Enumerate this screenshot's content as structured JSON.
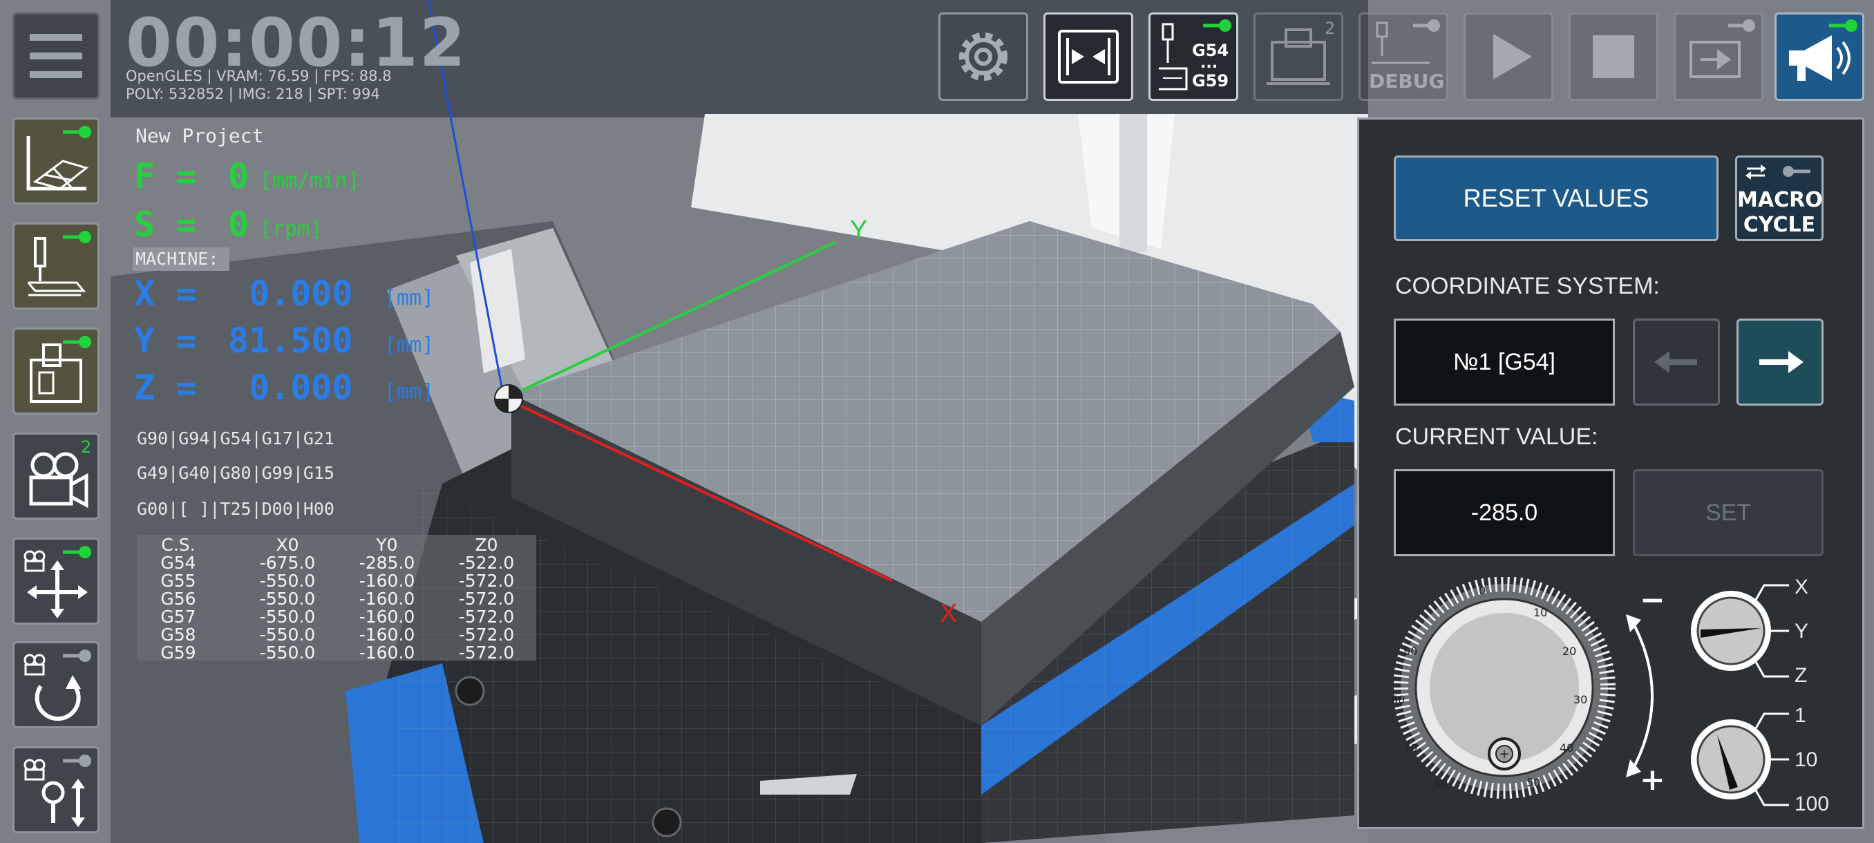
{
  "timer": "00:00:12",
  "stats_line1": "OpenGLES | VRAM: 76.59 | FPS: 88.8",
  "stats_line2": "POLY: 532852 | IMG: 218 | SPT: 994",
  "project_name": "New Project",
  "feed": {
    "label": "F =",
    "value": "0",
    "unit": "[mm/min]"
  },
  "speed": {
    "label": "S =",
    "value": "0",
    "unit": "[rpm]"
  },
  "machine_label": "MACHINE:",
  "axes": [
    {
      "label": "X =",
      "value": "0.000",
      "unit": "[mm]"
    },
    {
      "label": "Y =",
      "value": "81.500",
      "unit": "[mm]"
    },
    {
      "label": "Z =",
      "value": "0.000",
      "unit": "[mm]"
    }
  ],
  "gcode_lines": [
    "G90|G94|G54|G17|G21",
    "G49|G40|G80|G99|G15",
    "G00|[ ]|T25|D00|H00"
  ],
  "cs_table": {
    "headers": [
      "C.S.",
      "X0",
      "Y0",
      "Z0"
    ],
    "rows": [
      [
        "G54",
        "-675.0",
        "-285.0",
        "-522.0"
      ],
      [
        "G55",
        "-550.0",
        "-160.0",
        "-572.0"
      ],
      [
        "G56",
        "-550.0",
        "-160.0",
        "-572.0"
      ],
      [
        "G57",
        "-550.0",
        "-160.0",
        "-572.0"
      ],
      [
        "G58",
        "-550.0",
        "-160.0",
        "-572.0"
      ],
      [
        "G59",
        "-550.0",
        "-160.0",
        "-572.0"
      ]
    ]
  },
  "scene_axes": {
    "x": "X",
    "y": "Y"
  },
  "toolbar": {
    "g54_top": "G54",
    "g54_dots": "...",
    "g54_bottom": "G59",
    "fixture_badge": "2",
    "debug_label": "DEBUG",
    "camera_badge": "2"
  },
  "panel": {
    "reset_label": "RESET VALUES",
    "macro_line1": "MACRO",
    "macro_line2": "CYCLE",
    "coord_system_label": "COORDINATE SYSTEM:",
    "coord_system_value": "№1 [G54]",
    "current_value_label": "CURRENT VALUE:",
    "current_value": "-285.0",
    "set_label": "SET",
    "minus": "−",
    "plus": "+",
    "axis_options": [
      "X",
      "Y",
      "Z"
    ],
    "step_options": [
      "1",
      "10",
      "100"
    ],
    "dial_ticks": [
      "0",
      "10",
      "20",
      "30",
      "40",
      "50",
      "60",
      "70",
      "80",
      "90"
    ]
  },
  "colors": {
    "accent_blue": "#1d5a8a",
    "green_pin": "#1fd33a",
    "axis_blue": "#2a7de6",
    "axis_green": "#27d03e",
    "axis_red": "#e02020"
  }
}
